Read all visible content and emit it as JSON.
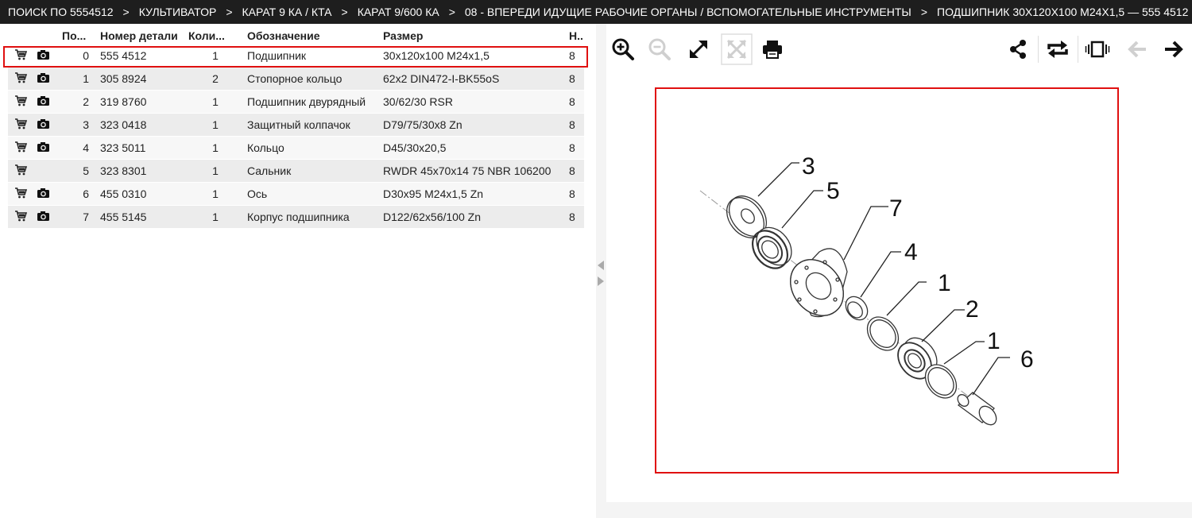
{
  "breadcrumb": [
    "ПОИСК ПО 5554512",
    "КУЛЬТИВАТОР",
    "КАРАТ 9 КА / КТА",
    "КАРАТ 9/600 КА",
    "08 - ВПЕРЕДИ ИДУЩИЕ РАБОЧИЕ ОРГАНЫ / ВСПОМОГАТЕЛЬНЫЕ ИНСТРУМЕНТЫ",
    "ПОДШИПНИК 30X120X100 M24X1,5 — 555 4512"
  ],
  "breadcrumb_separator": ">",
  "table": {
    "headers": {
      "pos": "По...",
      "part_number": "Номер детали",
      "qty": "Коли...",
      "designation": "Обозначение",
      "size": "Размер",
      "n": "Н.."
    },
    "rows": [
      {
        "pos": "0",
        "part_number": "555 4512",
        "qty": "1",
        "designation": "Подшипник",
        "size": "30x120x100 M24x1,5",
        "n": "8",
        "cart": true,
        "photo": true
      },
      {
        "pos": "1",
        "part_number": "305 8924",
        "qty": "2",
        "designation": "Стопорное кольцо",
        "size": "62x2 DIN472-I-BK55oS",
        "n": "8",
        "cart": true,
        "photo": true
      },
      {
        "pos": "2",
        "part_number": "319 8760",
        "qty": "1",
        "designation": "Подшипник двурядный",
        "size": "30/62/30 RSR",
        "n": "8",
        "cart": true,
        "photo": true
      },
      {
        "pos": "3",
        "part_number": "323 0418",
        "qty": "1",
        "designation": "Защитный колпачок",
        "size": "D79/75/30x8 Zn",
        "n": "8",
        "cart": true,
        "photo": true
      },
      {
        "pos": "4",
        "part_number": "323 5011",
        "qty": "1",
        "designation": "Кольцо",
        "size": "D45/30x20,5",
        "n": "8",
        "cart": true,
        "photo": true
      },
      {
        "pos": "5",
        "part_number": "323 8301",
        "qty": "1",
        "designation": "Сальник",
        "size": "RWDR 45x70x14 75 NBR 106200",
        "n": "8",
        "cart": true,
        "photo": false
      },
      {
        "pos": "6",
        "part_number": "455 0310",
        "qty": "1",
        "designation": "Ось",
        "size": "D30x95 M24x1,5 Zn",
        "n": "8",
        "cart": true,
        "photo": true
      },
      {
        "pos": "7",
        "part_number": "455 5145",
        "qty": "1",
        "designation": "Корпус подшипника",
        "size": "D122/62x56/100 Zn",
        "n": "8",
        "cart": true,
        "photo": true
      }
    ]
  },
  "toolbar": {
    "left": [
      "zoom-in-icon",
      "zoom-out-icon",
      "fullscreen-icon",
      "fit-icon",
      "print-icon"
    ],
    "right": [
      "share-icon",
      "repeat-icon",
      "carousel-icon",
      "arrow-left-icon",
      "arrow-right-icon"
    ],
    "disabled": [
      "zoom-out-icon",
      "fit-icon",
      "arrow-left-icon"
    ]
  },
  "diagram": {
    "callouts": [
      "3",
      "5",
      "7",
      "4",
      "1",
      "2",
      "1",
      "6"
    ]
  },
  "colors": {
    "highlight": "#e01010",
    "header_bg": "#1e1e1e",
    "row_alt": "#ececec"
  }
}
